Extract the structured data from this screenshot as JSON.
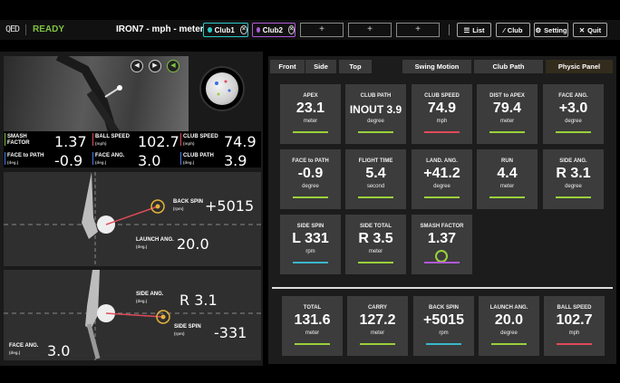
{
  "header": {
    "status": "READY",
    "club_info": "IRON7 - mph - meter",
    "clubs": [
      {
        "label": "Club1",
        "color": "#2ec8c8"
      },
      {
        "label": "Club2",
        "color": "#b05ad6"
      }
    ],
    "add_slot": "+",
    "buttons": {
      "list": "List",
      "club": "Club",
      "setting": "Setting",
      "quit": "Quit"
    }
  },
  "left": {
    "stats": [
      {
        "label": "SMASH",
        "label2": "FACTOR",
        "unit": "",
        "value": "1.37",
        "color": "#7fc241"
      },
      {
        "label": "BALL SPEED",
        "label2": "",
        "unit": "(mph)",
        "value": "102.7",
        "color": "#e04a5a"
      },
      {
        "label": "CLUB SPEED",
        "label2": "",
        "unit": "(mph)",
        "value": "74.9",
        "color": "#e04a5a"
      },
      {
        "label": "FACE to PATH",
        "label2": "",
        "unit": "(deg.)",
        "value": "-0.9",
        "color": "#4a7ae0"
      },
      {
        "label": "FACE ANG.",
        "label2": "",
        "unit": "(deg.)",
        "value": "3.0",
        "color": "#4a7ae0"
      },
      {
        "label": "CLUB PATH",
        "label2": "",
        "unit": "(deg.)",
        "value": "3.9",
        "color": "#4a7ae0"
      }
    ],
    "back_spin": {
      "label": "BACK SPIN",
      "unit": "(rpm)",
      "value": "+5015"
    },
    "launch_angle": {
      "label": "LAUNCH ANG.",
      "unit": "(deg.)",
      "value": "20.0"
    },
    "side_angle": {
      "label": "SIDE ANG.",
      "unit": "(deg.)",
      "value": "R 3.1"
    },
    "side_spin": {
      "label": "SIDE SPIN",
      "unit": "(rpm)",
      "value": "-331"
    },
    "face_angle": {
      "label": "FACE ANG.",
      "unit": "(deg.)",
      "value": "3.0"
    }
  },
  "tabs": {
    "views": [
      "Front",
      "Side",
      "Top"
    ],
    "panels": [
      "Swing Motion",
      "Club Path",
      "Physic Panel"
    ],
    "active": "Physic Panel"
  },
  "cards": [
    {
      "label": "APEX",
      "value": "23.1",
      "unit": "meter",
      "color": "#9ad13b"
    },
    {
      "label": "CLUB PATH",
      "value": "INOUT 3.9",
      "unit": "degree",
      "color": "#9ad13b"
    },
    {
      "label": "CLUB SPEED",
      "value": "74.9",
      "unit": "mph",
      "color": "#e04a5a"
    },
    {
      "label": "DIST to APEX",
      "value": "79.4",
      "unit": "meter",
      "color": "#9ad13b"
    },
    {
      "label": "FACE ANG.",
      "value": "+3.0",
      "unit": "degree",
      "color": "#9ad13b"
    },
    {
      "label": "FACE to PATH",
      "value": "-0.9",
      "unit": "degree",
      "color": "#9ad13b"
    },
    {
      "label": "FLIGHT TIME",
      "value": "5.4",
      "unit": "second",
      "color": "#9ad13b"
    },
    {
      "label": "LAND. ANG.",
      "value": "+41.2",
      "unit": "degree",
      "color": "#9ad13b"
    },
    {
      "label": "RUN",
      "value": "4.4",
      "unit": "meter",
      "color": "#9ad13b"
    },
    {
      "label": "SIDE ANG.",
      "value": "R 3.1",
      "unit": "degree",
      "color": "#9ad13b"
    },
    {
      "label": "SIDE SPIN",
      "value": "L 331",
      "unit": "rpm",
      "color": "#39b7c9"
    },
    {
      "label": "SIDE TOTAL",
      "value": "R 3.5",
      "unit": "meter",
      "color": "#9ad13b"
    },
    {
      "label": "SMASH FACTOR",
      "value": "1.37",
      "unit": "",
      "color": "#b05ad6"
    }
  ],
  "bottom_cards": [
    {
      "label": "TOTAL",
      "value": "131.6",
      "unit": "meter",
      "color": "#9ad13b"
    },
    {
      "label": "CARRY",
      "value": "127.2",
      "unit": "meter",
      "color": "#9ad13b"
    },
    {
      "label": "BACK SPIN",
      "value": "+5015",
      "unit": "rpm",
      "color": "#39b7c9"
    },
    {
      "label": "LAUNCH ANG.",
      "value": "20.0",
      "unit": "degree",
      "color": "#9ad13b"
    },
    {
      "label": "BALL SPEED",
      "value": "102.7",
      "unit": "mph",
      "color": "#e04a5a"
    }
  ]
}
